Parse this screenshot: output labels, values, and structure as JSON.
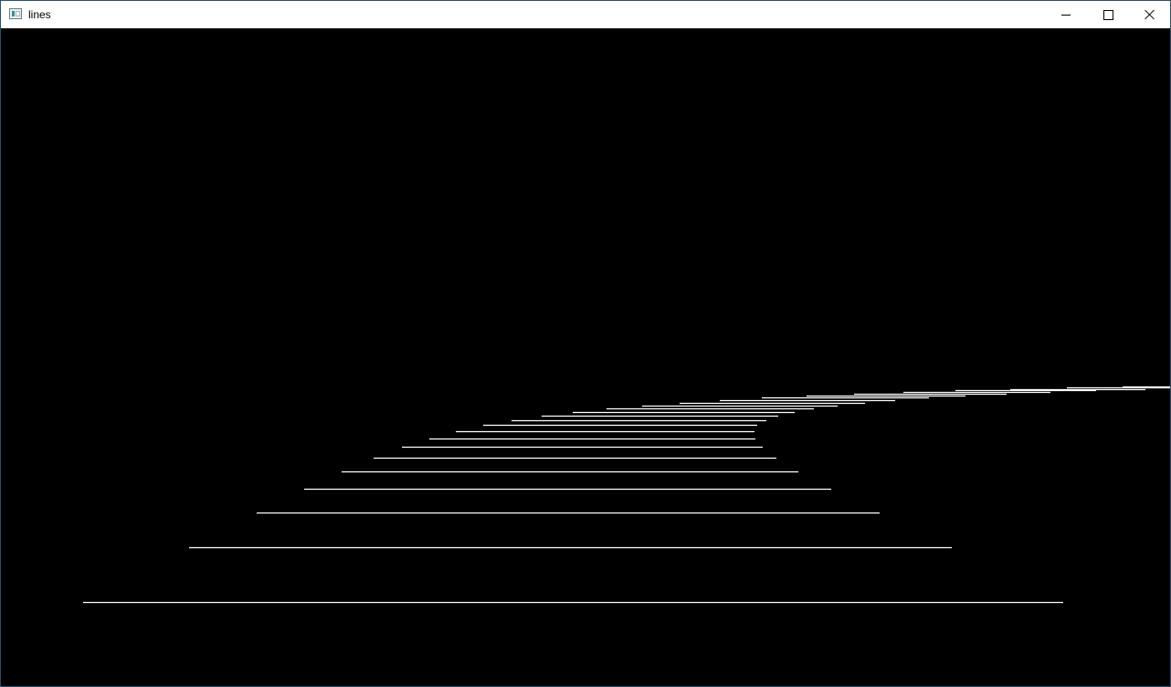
{
  "window": {
    "title": "lines",
    "icon": "app-window-icon",
    "controls": {
      "minimize_icon": "minimize-icon",
      "maximize_icon": "maximize-icon",
      "close_icon": "close-icon"
    }
  },
  "canvas": {
    "background": "#000000",
    "line_color": "#ffffff"
  }
}
